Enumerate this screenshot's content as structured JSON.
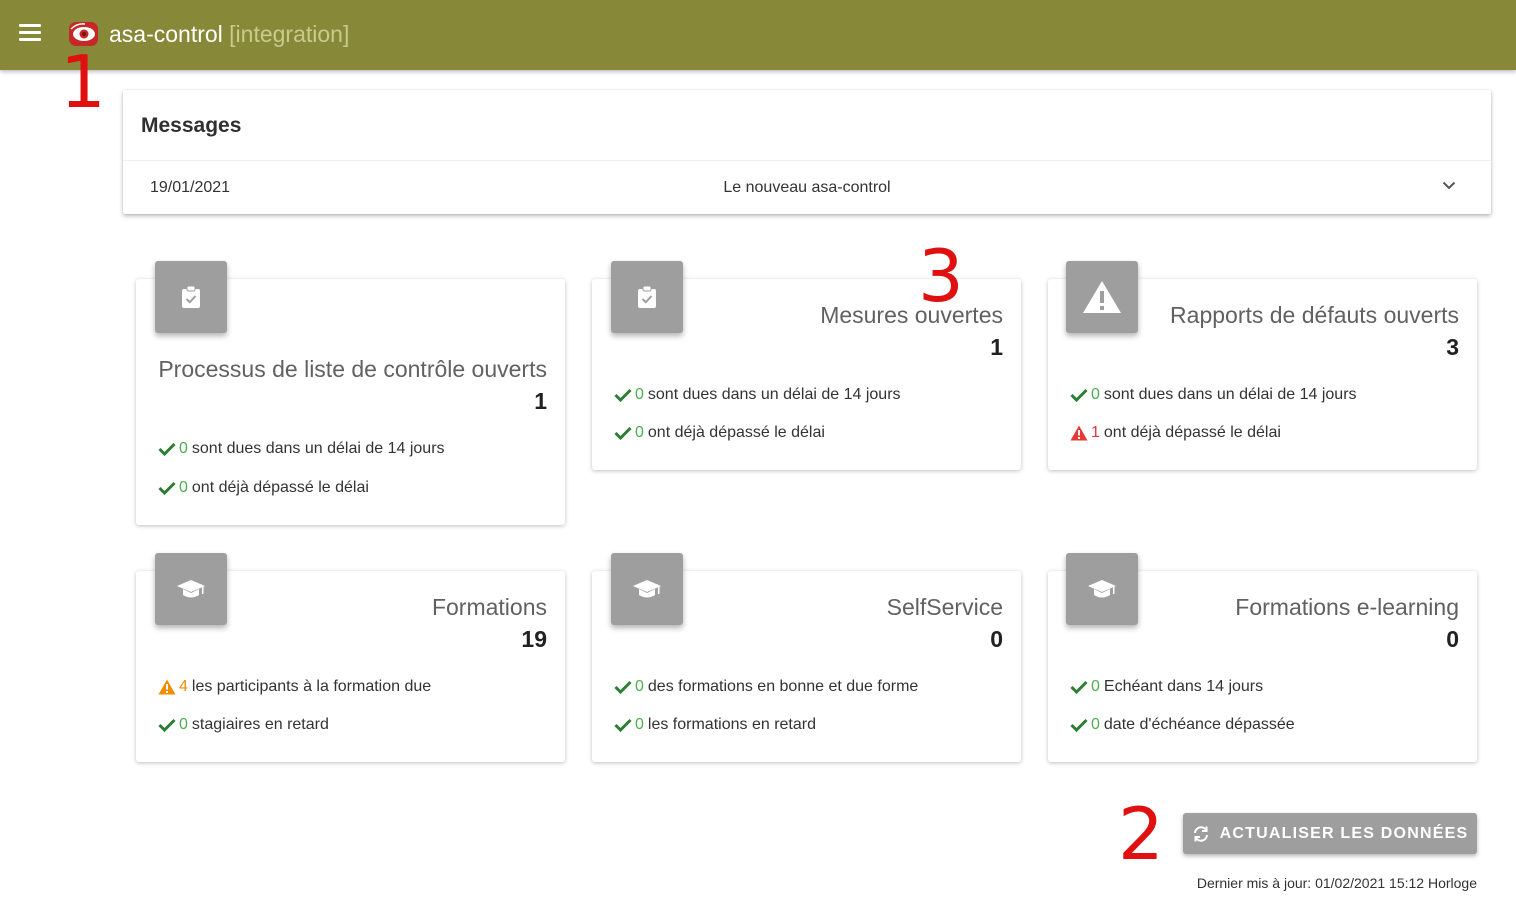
{
  "header": {
    "app_name": "asa-control",
    "environment": "[integration]",
    "menu_icon": "menu-icon",
    "logo_icon": "eye-logo-icon"
  },
  "annotations": [
    "1",
    "2",
    "3"
  ],
  "messages": {
    "title": "Messages",
    "items": [
      {
        "date": "19/01/2021",
        "text": "Le nouveau asa-control"
      }
    ]
  },
  "cards": [
    {
      "title": "Processus de liste de contrôle ouverts",
      "count": "1",
      "icon": "clipboard-check-icon",
      "stats": [
        {
          "status": "ok",
          "value": "0",
          "text": "sont dues dans un délai de 14 jours"
        },
        {
          "status": "ok",
          "value": "0",
          "text": "ont déjà dépassé le délai"
        }
      ]
    },
    {
      "title": "Mesures ouvertes",
      "count": "1",
      "icon": "clipboard-check-icon",
      "stats": [
        {
          "status": "ok",
          "value": "0",
          "text": "sont dues dans un délai de 14 jours"
        },
        {
          "status": "ok",
          "value": "0",
          "text": "ont déjà dépassé le délai"
        }
      ]
    },
    {
      "title": "Rapports de défauts ouverts",
      "count": "3",
      "icon": "warning-icon",
      "stats": [
        {
          "status": "ok",
          "value": "0",
          "text": "sont dues dans un délai de 14 jours"
        },
        {
          "status": "error",
          "value": "1",
          "text": "ont déjà dépassé le délai"
        }
      ]
    },
    {
      "title": "Formations",
      "count": "19",
      "icon": "graduation-cap-icon",
      "stats": [
        {
          "status": "warning",
          "value": "4",
          "text": "les participants à la formation due"
        },
        {
          "status": "ok",
          "value": "0",
          "text": "stagiaires en retard"
        }
      ]
    },
    {
      "title": "SelfService",
      "count": "0",
      "icon": "graduation-cap-icon",
      "stats": [
        {
          "status": "ok",
          "value": "0",
          "text": "des formations en bonne et due forme"
        },
        {
          "status": "ok",
          "value": "0",
          "text": "les formations en retard"
        }
      ]
    },
    {
      "title": "Formations e-learning",
      "count": "0",
      "icon": "graduation-cap-icon",
      "stats": [
        {
          "status": "ok",
          "value": "0",
          "text": "Echéant dans 14 jours"
        },
        {
          "status": "ok",
          "value": "0",
          "text": "date d'échéance dépassée"
        }
      ]
    }
  ],
  "footer": {
    "refresh_label": "ACTUALISER LES DONNÉES",
    "last_update": "Dernier mis à jour: 01/02/2021 15:12 Horloge"
  },
  "colors": {
    "appbar": "#888938",
    "ok": "#2e7d32",
    "ok_number": "#4caf50",
    "warning": "#ef8c00",
    "error": "#e53935",
    "icon_box": "#9e9e9e",
    "annotation": "#e01010"
  }
}
